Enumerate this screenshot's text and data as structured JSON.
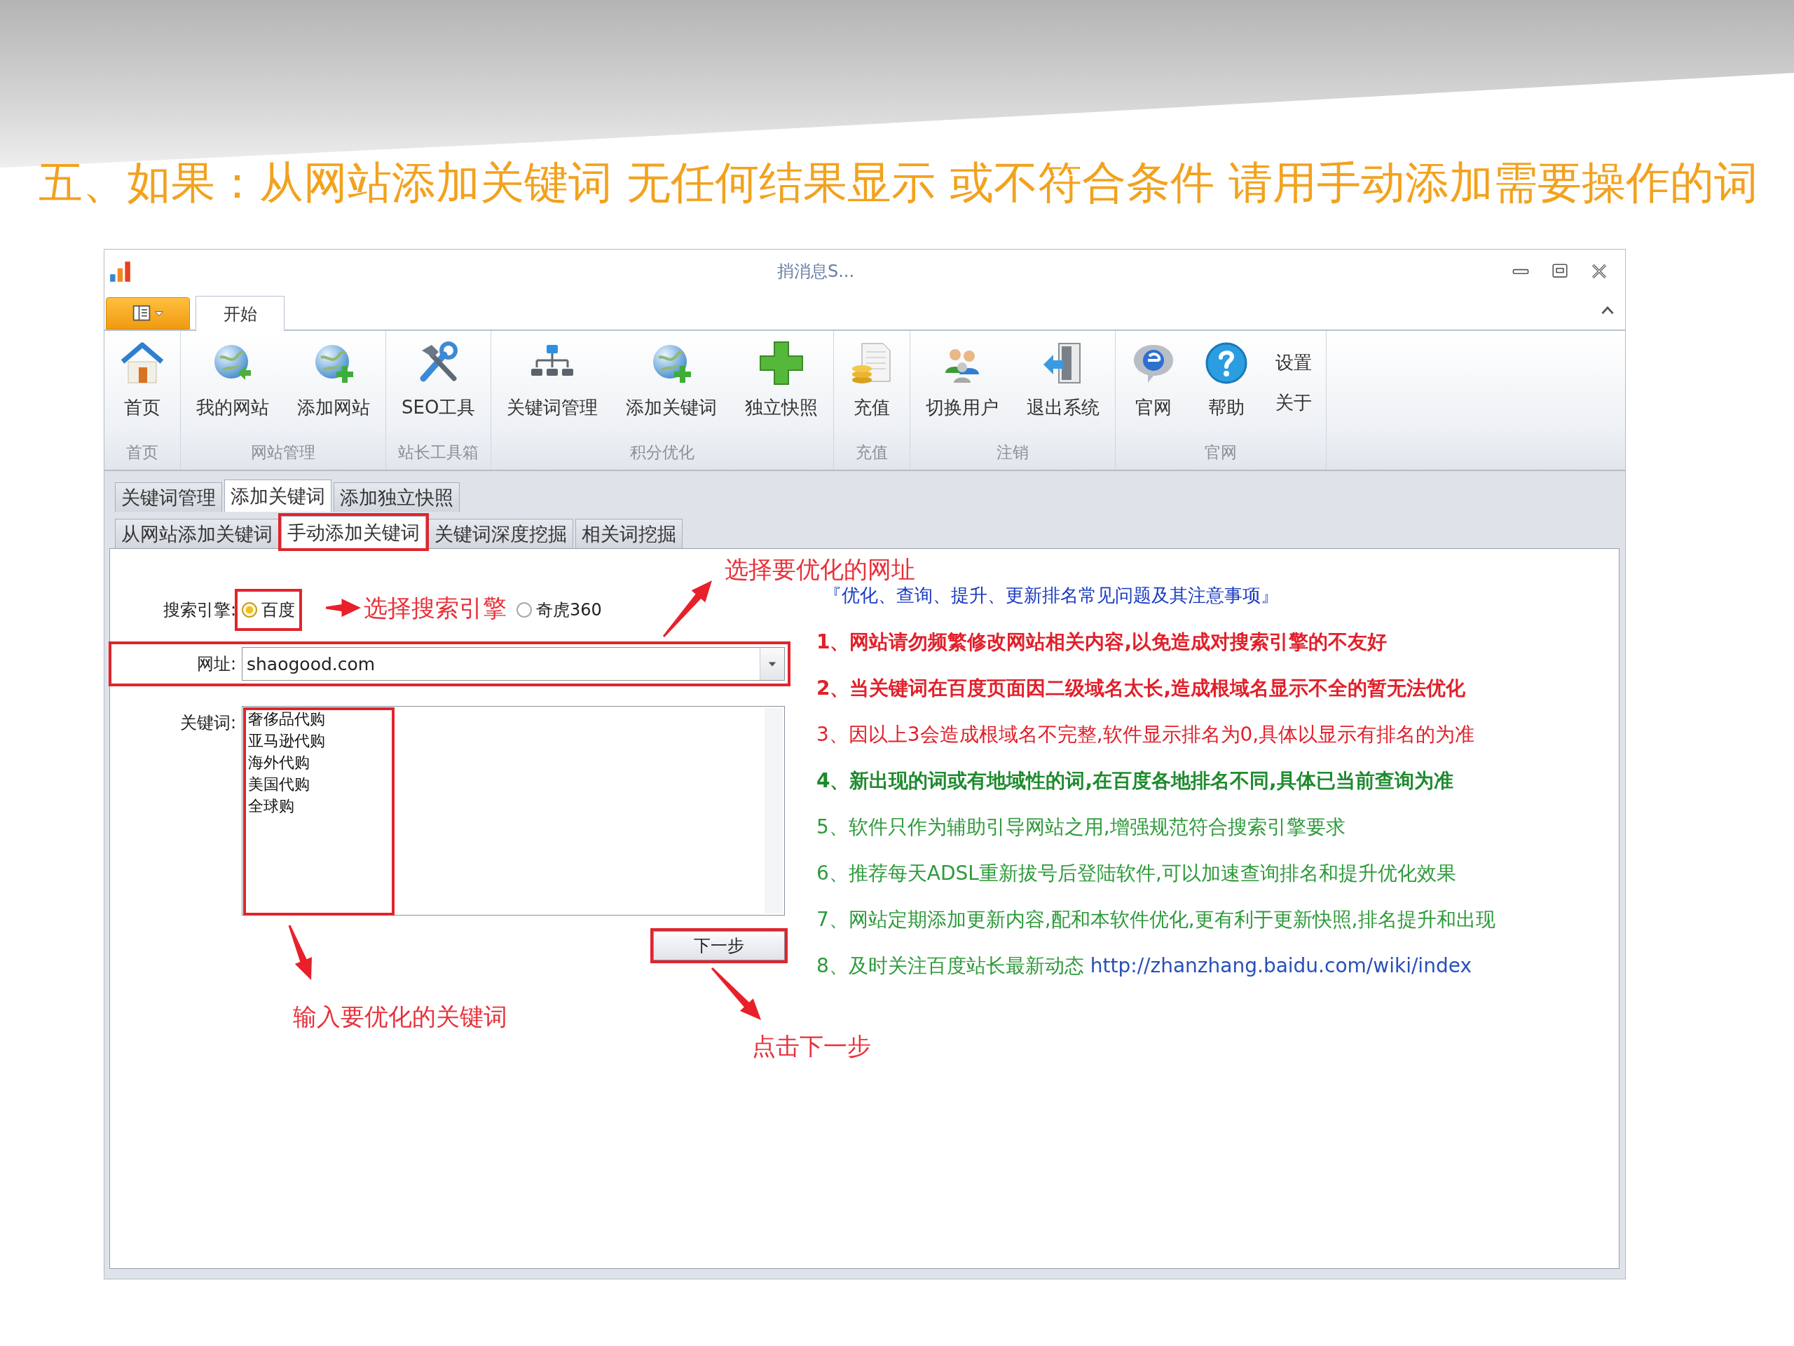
{
  "slide_title": "五、如果：从网站添加关键词 无任何结果显示 或不符合条件 请用手动添加需要操作的词",
  "window": {
    "title": "捎消息S..."
  },
  "ribbon_tabs": [
    {
      "label": "开始",
      "selected": true
    }
  ],
  "ribbon_groups": [
    {
      "label": "首页",
      "buttons": [
        {
          "label": "首页",
          "kind": "large"
        }
      ]
    },
    {
      "label": "网站管理",
      "buttons": [
        {
          "label": "我的网站",
          "kind": "large"
        },
        {
          "label": "添加网站",
          "kind": "large"
        }
      ]
    },
    {
      "label": "站长工具箱",
      "buttons": [
        {
          "label": "SEO工具",
          "kind": "large"
        }
      ]
    },
    {
      "label": "积分优化",
      "buttons": [
        {
          "label": "关键词管理",
          "kind": "large"
        },
        {
          "label": "添加关键词",
          "kind": "large"
        },
        {
          "label": "独立快照",
          "kind": "large"
        }
      ]
    },
    {
      "label": "充值",
      "buttons": [
        {
          "label": "充值",
          "kind": "large"
        }
      ]
    },
    {
      "label": "注销",
      "buttons": [
        {
          "label": "切换用户",
          "kind": "large"
        },
        {
          "label": "退出系统",
          "kind": "large"
        }
      ]
    },
    {
      "label": "官网",
      "buttons": [
        {
          "label": "官网",
          "kind": "large"
        },
        {
          "label": "帮助",
          "kind": "large"
        },
        {
          "label": "设置",
          "kind": "small"
        },
        {
          "label": "关于",
          "kind": "small"
        }
      ]
    }
  ],
  "page_tabs": [
    {
      "label": "关键词管理",
      "selected": false
    },
    {
      "label": "添加关键词",
      "selected": true
    },
    {
      "label": "添加独立快照",
      "selected": false
    }
  ],
  "sub_tabs": [
    {
      "label": "从网站添加关键词",
      "selected": false
    },
    {
      "label": "手动添加关键词",
      "selected": true
    },
    {
      "label": "关键词深度挖掘",
      "selected": false
    },
    {
      "label": "相关词挖掘",
      "selected": false
    }
  ],
  "form": {
    "engine_label": "搜索引擎:",
    "engines": [
      {
        "label": "百度",
        "selected": true
      },
      {
        "label": "奇虎360",
        "selected": false
      }
    ],
    "url_label": "网址:",
    "url_value": "shaogood.com",
    "keywords_label": "关键词:",
    "keywords": [
      "奢侈品代购",
      "亚马逊代购",
      "海外代购",
      "美国代购",
      "全球购"
    ],
    "next_button": "下一步"
  },
  "notes_title": "『优化、查询、提升、更新排名常见问题及其注意事项』",
  "notes": [
    {
      "text": "1、网站请勿频繁修改网站相关内容,以免造成对搜索引擎的不友好",
      "color": "#e0202a",
      "bold": true
    },
    {
      "text": "2、当关键词在百度页面因二级域名太长,造成根域名显示不全的暂无法优化",
      "color": "#e0202a",
      "bold": true
    },
    {
      "text": "3、因以上3会造成根域名不完整,软件显示排名为0,具体以显示有排名的为准",
      "color": "#e0202a",
      "bold": false
    },
    {
      "text": "4、新出现的词或有地域性的词,在百度各地排名不同,具体已当前查询为准",
      "color": "#1e8a2e",
      "bold": true
    },
    {
      "text": "5、软件只作为辅助引导网站之用,增强规范符合搜索引擎要求",
      "color": "#2e9a3a",
      "bold": false
    },
    {
      "text": "6、推荐每天ADSL重新拔号后登陆软件,可以加速查询排名和提升优化效果",
      "color": "#2e9a3a",
      "bold": false
    },
    {
      "text": "7、网站定期添加更新内容,配和本软件优化,更有利于更新快照,排名提升和出现",
      "color": "#2e9a3a",
      "bold": false
    },
    {
      "text": "8、及时关注百度站长最新动态",
      "color": "#2e9a3a",
      "bold": false,
      "link": "http://zhanzhang.baidu.com/wiki/index"
    }
  ],
  "annotations": [
    {
      "text": "选择要优化的网址"
    },
    {
      "text": "选择搜索引擎"
    },
    {
      "text": "输入要优化的关键词"
    },
    {
      "text": "点击下一步"
    }
  ]
}
